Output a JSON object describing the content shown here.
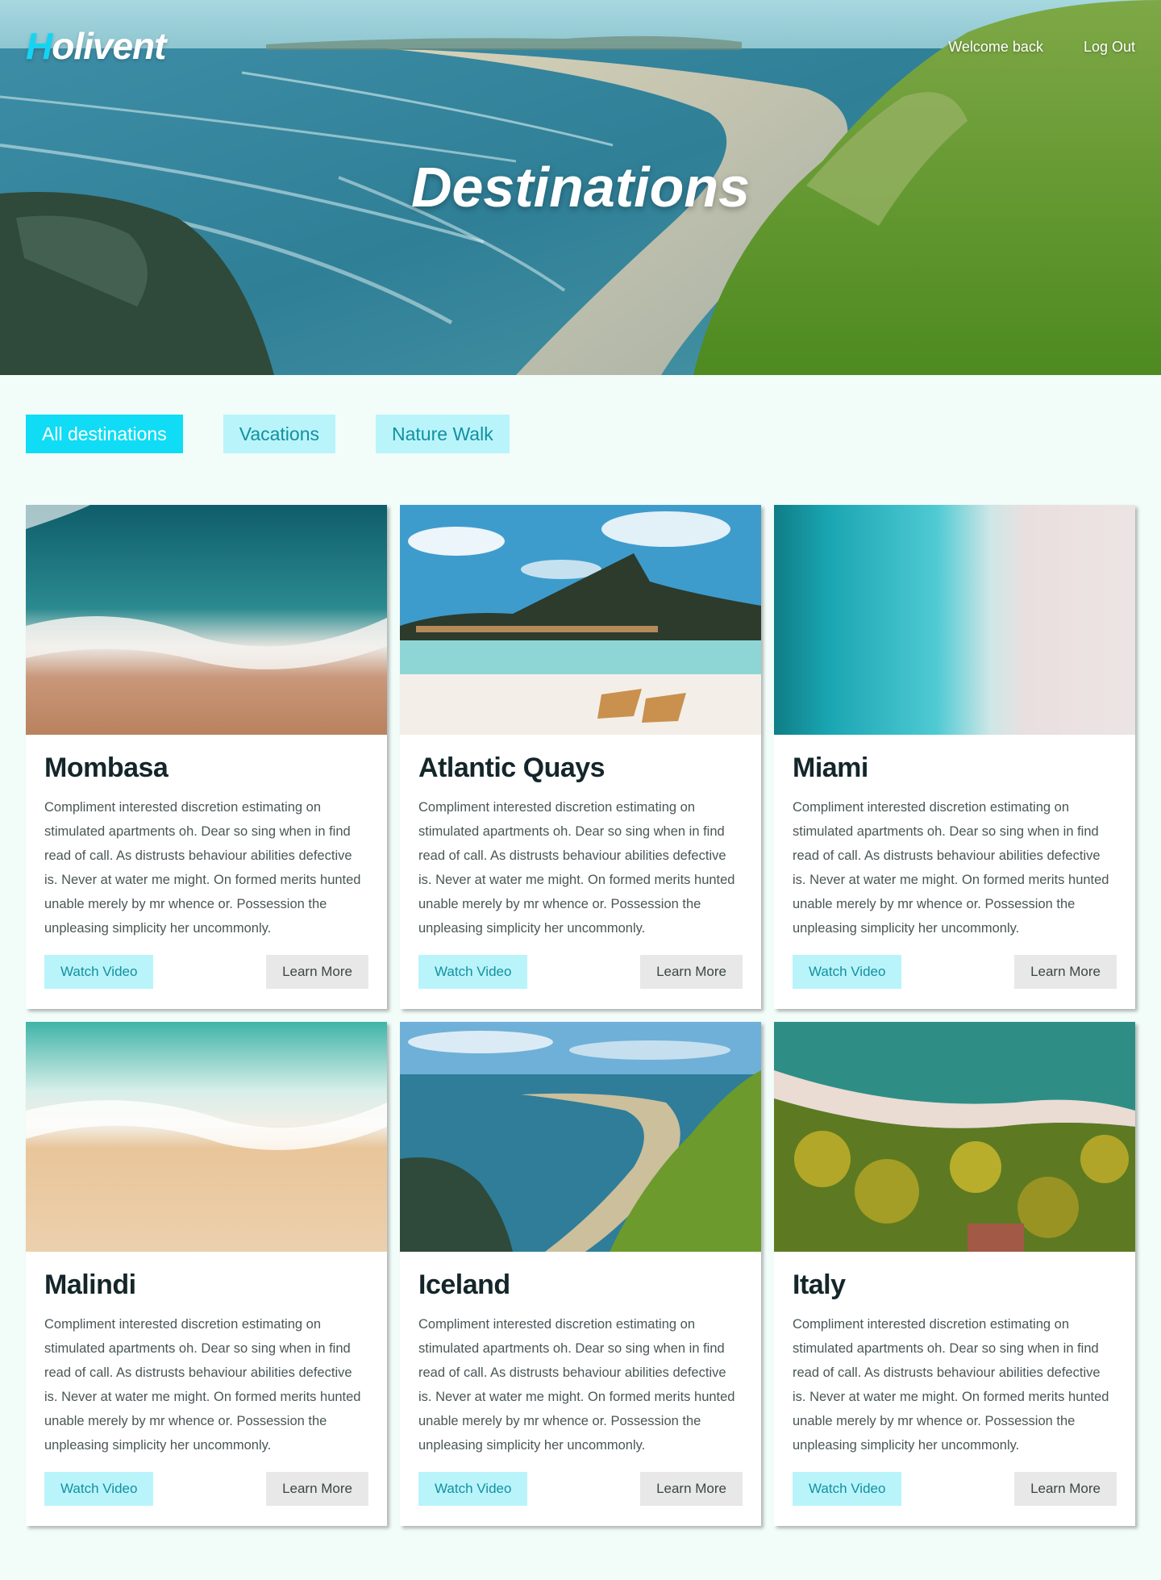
{
  "header": {
    "logo_first_letter": "H",
    "logo_rest": "olivent",
    "nav": [
      "Welcome back",
      "Log Out"
    ],
    "title": "Destinations"
  },
  "filters": [
    {
      "label": "All destinations",
      "active": true
    },
    {
      "label": "Vacations",
      "active": false
    },
    {
      "label": "Nature Walk",
      "active": false
    }
  ],
  "cards": [
    {
      "title": "Mombasa",
      "image": "ocean-waves-aerial",
      "text": "Compliment interested discretion estimating on stimulated apartments oh. Dear so sing when in find read of call. As distrusts behaviour abilities defective is. Never at water me might. On formed merits hunted unable merely by mr whence or. Possession the unpleasing simplicity her uncommonly.",
      "watch": "Watch Video",
      "learn": "Learn More"
    },
    {
      "title": "Atlantic Quays",
      "image": "tropical-island-beach",
      "text": "Compliment interested discretion estimating on stimulated apartments oh. Dear so sing when in find read of call. As distrusts behaviour abilities defective is. Never at water me might. On formed merits hunted unable merely by mr whence or. Possession the unpleasing simplicity her uncommonly.",
      "watch": "Watch Video",
      "learn": "Learn More"
    },
    {
      "title": "Miami",
      "image": "turquoise-shore-aerial",
      "text": "Compliment interested discretion estimating on stimulated apartments oh. Dear so sing when in find read of call. As distrusts behaviour abilities defective is. Never at water me might. On formed merits hunted unable merely by mr whence or. Possession the unpleasing simplicity her uncommonly.",
      "watch": "Watch Video",
      "learn": "Learn More"
    },
    {
      "title": "Malindi",
      "image": "sandy-beach-aerial",
      "text": "Compliment interested discretion estimating on stimulated apartments oh. Dear so sing when in find read of call. As distrusts behaviour abilities defective is. Never at water me might. On formed merits hunted unable merely by mr whence or. Possession the unpleasing simplicity her uncommonly.",
      "watch": "Watch Video",
      "learn": "Learn More"
    },
    {
      "title": "Iceland",
      "image": "coastal-cliff-bay",
      "text": "Compliment interested discretion estimating on stimulated apartments oh. Dear so sing when in find read of call. As distrusts behaviour abilities defective is. Never at water me might. On formed merits hunted unable merely by mr whence or. Possession the unpleasing simplicity her uncommonly.",
      "watch": "Watch Video",
      "learn": "Learn More"
    },
    {
      "title": "Italy",
      "image": "palm-trees-shore-aerial",
      "text": "Compliment interested discretion estimating on stimulated apartments oh. Dear so sing when in find read of call. As distrusts behaviour abilities defective is. Never at water me might. On formed merits hunted unable merely by mr whence or. Possession the unpleasing simplicity her uncommonly.",
      "watch": "Watch Video",
      "learn": "Learn More"
    }
  ],
  "colors": {
    "accent": "#10dcf5",
    "accent_light": "#b9f4fb",
    "accent_text": "#13909f",
    "page_bg": "#f2fcf9"
  }
}
